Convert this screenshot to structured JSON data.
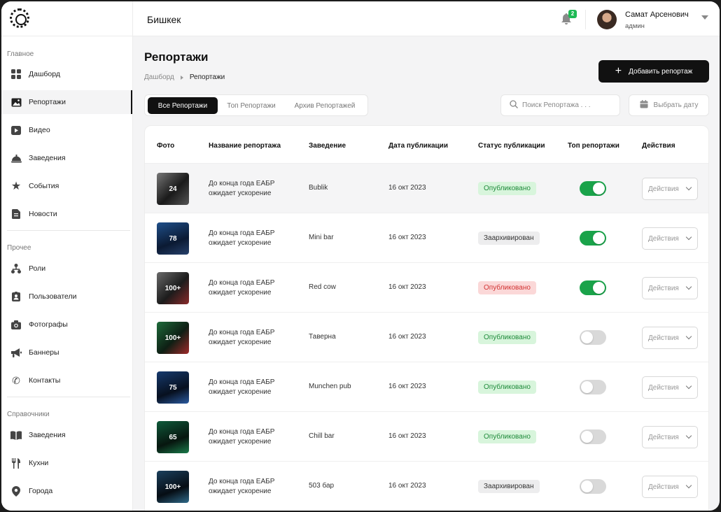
{
  "header": {
    "city": "Бишкек",
    "notifications": "2",
    "user_name": "Самат Арсенович",
    "user_role": "админ"
  },
  "sidebar": {
    "section_main": "Главное",
    "main_items": [
      {
        "label": "Дашборд",
        "icon": "grid-icon"
      },
      {
        "label": "Репортажи",
        "icon": "image-icon"
      },
      {
        "label": "Видео",
        "icon": "play-icon"
      },
      {
        "label": "Заведения",
        "icon": "cloche-icon"
      },
      {
        "label": "События",
        "icon": "star-icon"
      },
      {
        "label": "Новости",
        "icon": "document-icon"
      }
    ],
    "section_other": "Прочее",
    "other_items": [
      {
        "label": "Роли",
        "icon": "hierarchy-icon"
      },
      {
        "label": "Пользователи",
        "icon": "id-badge-icon"
      },
      {
        "label": "Фотографы",
        "icon": "camera-icon"
      },
      {
        "label": "Баннеры",
        "icon": "megaphone-icon"
      },
      {
        "label": "Контакты",
        "icon": "phone-icon"
      }
    ],
    "section_refs": "Справочники",
    "ref_items": [
      {
        "label": "Заведения",
        "icon": "book-icon"
      },
      {
        "label": "Кухни",
        "icon": "fork-knife-icon"
      },
      {
        "label": "Города",
        "icon": "location-pin-icon"
      }
    ]
  },
  "page": {
    "title": "Репортажи",
    "breadcrumb": [
      "Дашборд",
      "Репортажи"
    ],
    "add_button": "Добавить репортаж",
    "tabs": [
      "Все Репортажи",
      "Топ Репортажи",
      "Архив Репортажей"
    ],
    "search_placeholder": "Поиск Репортажа . . .",
    "date_button": "Выбрать дату"
  },
  "table": {
    "columns": [
      "Фото",
      "Название репортажа",
      "Заведение",
      "Дата публикации",
      "Статус публикации",
      "Топ репортажи",
      "Действия"
    ],
    "rows": [
      {
        "photos": "24",
        "title": "До конца года ЕАБР ожидает ускорение",
        "place": "Bublik",
        "date": "16 окт 2023",
        "status": "Опубликовано",
        "status_color": "green",
        "top": true,
        "action": "Действия"
      },
      {
        "photos": "78",
        "title": "До конца года ЕАБР ожидает ускорение",
        "place": "Mini bar",
        "date": "16 окт 2023",
        "status": "Заархивирован",
        "status_color": "gray",
        "top": true,
        "action": "Действия"
      },
      {
        "photos": "100+",
        "title": "До конца года ЕАБР ожидает ускорение",
        "place": "Red cow",
        "date": "16 окт 2023",
        "status": "Опубликовано",
        "status_color": "red",
        "top": true,
        "action": "Действия"
      },
      {
        "photos": "100+",
        "title": "До конца года ЕАБР ожидает ускорение",
        "place": "Таверна",
        "date": "16 окт 2023",
        "status": "Опубликовано",
        "status_color": "green",
        "top": false,
        "action": "Действия"
      },
      {
        "photos": "75",
        "title": "До конца года ЕАБР ожидает ускорение",
        "place": "Munchen pub",
        "date": "16 окт 2023",
        "status": "Опубликовано",
        "status_color": "green",
        "top": false,
        "action": "Действия"
      },
      {
        "photos": "65",
        "title": "До конца года ЕАБР ожидает ускорение",
        "place": "Chill bar",
        "date": "16 окт 2023",
        "status": "Опубликовано",
        "status_color": "green",
        "top": false,
        "action": "Действия"
      },
      {
        "photos": "100+",
        "title": "До конца года ЕАБР ожидает ускорение",
        "place": "503 бар",
        "date": "16 окт 2023",
        "status": "Заархивирован",
        "status_color": "gray",
        "top": false,
        "action": "Действия"
      }
    ]
  },
  "colors": {
    "accent": "#111111",
    "toggle_on": "#1aa34a",
    "status_green": "#1e8a3a",
    "status_red": "#d23333"
  }
}
